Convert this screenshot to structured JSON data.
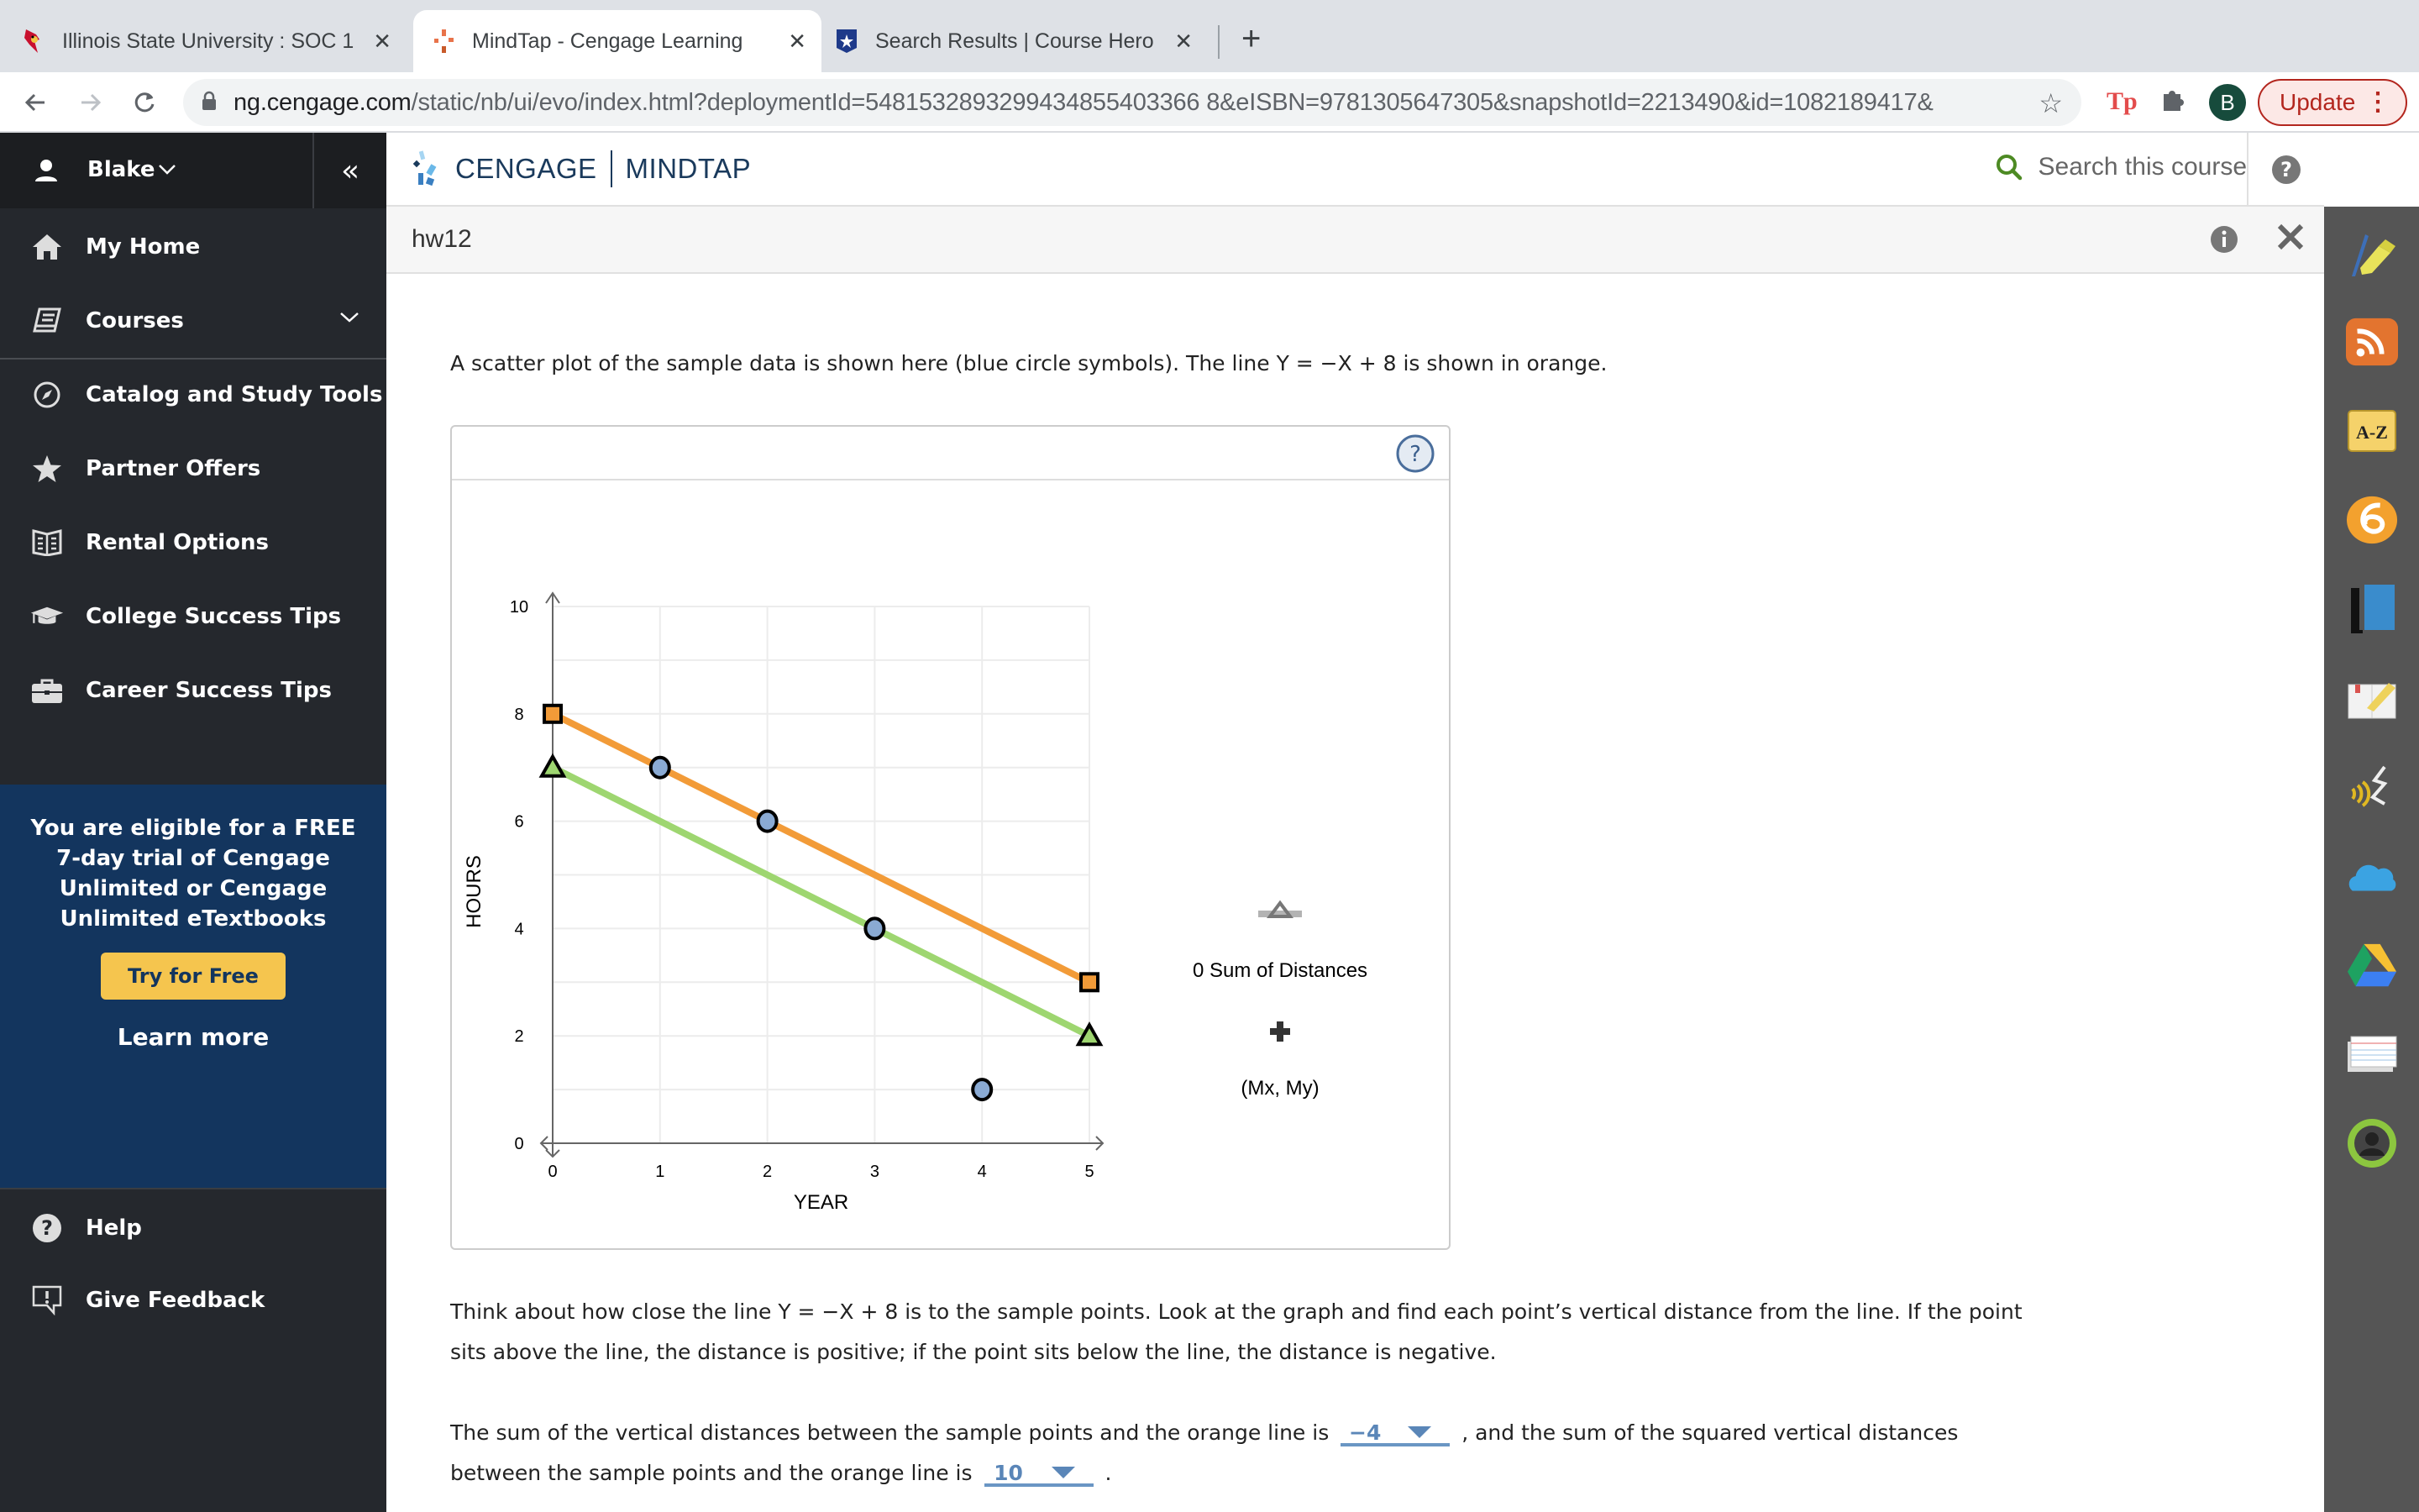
{
  "browser": {
    "tabs": [
      {
        "title": "Illinois State University : SOC 1",
        "icon": "cardinal-favicon",
        "active": false
      },
      {
        "title": "MindTap - Cengage Learning",
        "icon": "cengage-favicon",
        "active": true
      },
      {
        "title": "Search Results | Course Hero",
        "icon": "coursehero-favicon",
        "active": false
      }
    ],
    "tab_close": "✕",
    "new_tab": "+",
    "url_host": "ng.cengage.com",
    "url_path": "/static/nb/ui/evo/index.html?deploymentId=5481532893299434855403366 8&eISBN=9781305647305&snapshotId=2213490&id=1082189417&",
    "profile_initial": "B",
    "update_label": "Update",
    "ext_tp": "Tp"
  },
  "sidebar": {
    "user": "Blake",
    "items": [
      {
        "label": "My Home",
        "icon": "home-icon"
      },
      {
        "label": "Courses",
        "icon": "book-icon"
      },
      {
        "label": "Catalog and Study Tools",
        "icon": "compass-icon"
      },
      {
        "label": "Partner Offers",
        "icon": "star-icon"
      },
      {
        "label": "Rental Options",
        "icon": "open-book-icon"
      },
      {
        "label": "College Success Tips",
        "icon": "graduation-cap-icon"
      },
      {
        "label": "Career Success Tips",
        "icon": "briefcase-icon"
      }
    ],
    "promo_text": "You are eligible for a FREE 7-day trial of Cengage Unlimited or Cengage Unlimited eTextbooks",
    "promo_button": "Try for Free",
    "promo_link": "Learn more",
    "footer_items": [
      {
        "label": "Help",
        "icon": "help-icon"
      },
      {
        "label": "Give Feedback",
        "icon": "feedback-icon"
      }
    ]
  },
  "header": {
    "brand": "CENGAGE",
    "product": "MINDTAP",
    "search_placeholder": "Search this course",
    "activity_title": "hw12"
  },
  "rail": {
    "items": [
      "highlighter-icon",
      "rss-icon",
      "a-z-glossary-icon",
      "cengage-app-icon",
      "ebook-icon",
      "notes-icon",
      "readspeaker-icon",
      "onedrive-icon",
      "google-drive-icon",
      "flashcards-icon",
      "profile-ring-icon"
    ]
  },
  "content": {
    "intro": "A scatter plot of the sample data is shown here (blue circle symbols). The line Y = −X + 8 is shown in orange.",
    "instructions_line1": "Think about how close the line Y = −X + 8 is to the sample points. Look at the graph and find each point’s vertical distance from the line. If the point",
    "instructions_line2": "sits above the line, the distance is positive; if the point sits below the line, the distance is negative.",
    "q_part1": "The sum of the vertical distances between the sample points and the orange line is",
    "q_answer1": "−4",
    "q_part2": ", and the sum of the squared vertical distances",
    "q_part3": "between the sample points and the orange line is",
    "q_answer2": "10",
    "q_part4": "."
  },
  "legend": {
    "sum_label": "0 Sum of Distances",
    "mean_label": "(Mx, My)"
  },
  "chart_data": {
    "type": "scatter",
    "title": "",
    "xlabel": "YEAR",
    "ylabel": "HOURS",
    "xlim": [
      0,
      5
    ],
    "ylim": [
      0,
      10
    ],
    "x_ticks": [
      "0",
      "1",
      "2",
      "3",
      "4",
      "5"
    ],
    "y_ticks": [
      "0",
      "2",
      "4",
      "6",
      "8",
      "10"
    ],
    "grid": true,
    "series": [
      {
        "name": "Sample data",
        "type": "scatter",
        "marker": "circle",
        "color": "#8aaad3",
        "points": [
          [
            1,
            7
          ],
          [
            2,
            6
          ],
          [
            3,
            4
          ],
          [
            4,
            1
          ]
        ]
      },
      {
        "name": "Orange line Y = -X + 8",
        "type": "line",
        "marker": "square",
        "color": "#f29b38",
        "points": [
          [
            0,
            8
          ],
          [
            5,
            3
          ]
        ]
      },
      {
        "name": "Green line",
        "type": "line",
        "marker": "triangle",
        "color": "#9ed670",
        "points": [
          [
            0,
            7
          ],
          [
            5,
            2
          ]
        ]
      }
    ],
    "legend": [
      "0 Sum of Distances",
      "(Mx, My)"
    ],
    "legend_position": "right"
  }
}
